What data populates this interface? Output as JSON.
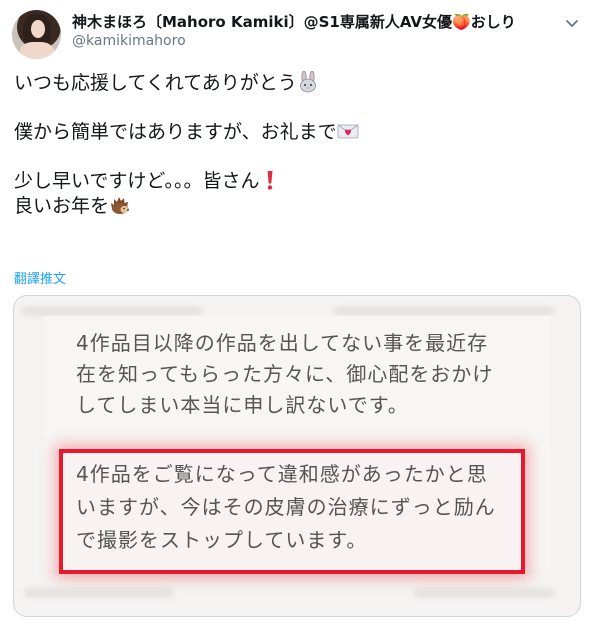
{
  "user": {
    "display_name": "神木まほろ〔Mahoro Kamiki〕@S1専属新人AV女優🍑おしり",
    "handle": "@kamikimahoro"
  },
  "tweet": {
    "line1": "いつも応援してくれてありがとう",
    "line2": "僕から簡単ではありますが、お礼まで",
    "line3": "少し早いですけど。。。皆さん",
    "line4": "良いお年を"
  },
  "icons": {
    "rabbit": "rabbit-emoji",
    "envelope": "love-letter-emoji",
    "exclamation": "exclamation-emoji",
    "hedgehog": "hedgehog-emoji",
    "caret": "chevron-down-icon"
  },
  "translate_label": "翻譯推文",
  "card": {
    "para1": [
      "4作品目以降の作品を出してない事を最近存",
      "在を知ってもらった方々に、御心配をおかけ",
      "してしまい本当に申し訳ないです。"
    ],
    "para2": [
      "4作品をご覧になって違和感があったかと思",
      "いますが、今はその皮膚の治療にずっと励ん",
      "で撮影をストップしています。"
    ]
  },
  "colors": {
    "link": "#1da1f2",
    "highlight_border": "#e8192c",
    "handle_gray": "#657786"
  }
}
